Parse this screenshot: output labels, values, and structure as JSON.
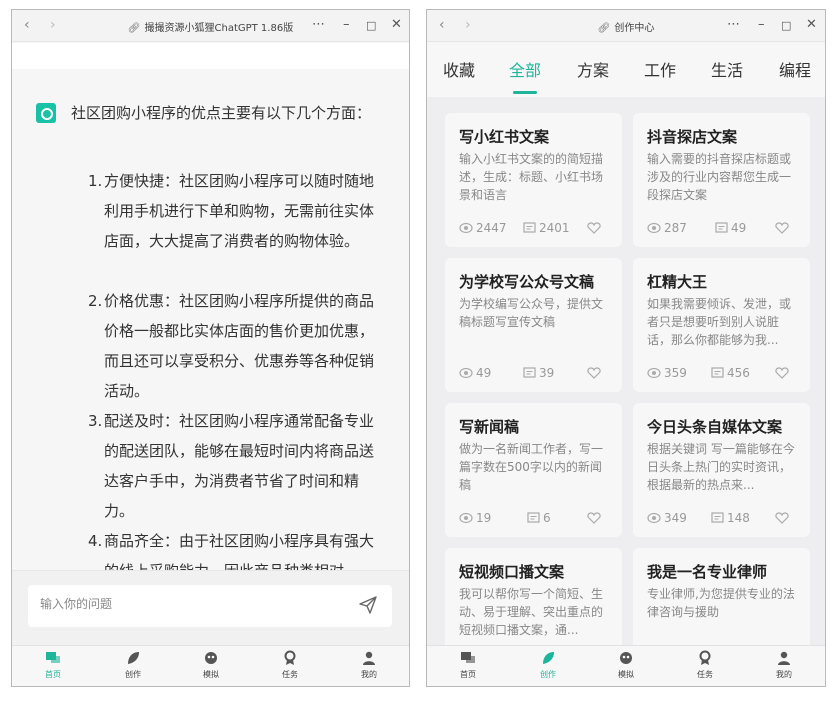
{
  "left_window": {
    "title": "撮撮资源小狐狸ChatGPT 1.86版",
    "message": {
      "intro": "社区团购小程序的优点主要有以下几个方面：",
      "points": [
        {
          "num": "1.",
          "text": "方便快捷：社区团购小程序可以随时随地利用手机进行下单和购物，无需前往实体店面，大大提高了消费者的购物体验。"
        },
        {
          "num": "2.",
          "text": "价格优惠：社区团购小程序所提供的商品价格一般都比实体店面的售价更加优惠，而且还可以享受积分、优惠券等各种促销活动。"
        },
        {
          "num": "3.",
          "text": "配送及时：社区团购小程序通常配备专业的配送团队，能够在最短时间内将商品送达客户手中，为消费者节省了时间和精力。"
        },
        {
          "num": "4.",
          "text": "商品齐全：由于社区团购小程序具有强大的线上采购能力，因此商品种类相对"
        }
      ]
    },
    "input": {
      "placeholder": "输入你的问题"
    },
    "tabs": [
      {
        "label": "首页",
        "icon": "chat-icon"
      },
      {
        "label": "创作",
        "icon": "leaf-icon"
      },
      {
        "label": "模拟",
        "icon": "mask-icon"
      },
      {
        "label": "任务",
        "icon": "medal-icon"
      },
      {
        "label": "我的",
        "icon": "user-icon"
      }
    ],
    "active_tab": "首页"
  },
  "right_window": {
    "title": "创作中心",
    "categories": [
      "收藏",
      "全部",
      "方案",
      "工作",
      "生活",
      "编程"
    ],
    "active_category": "全部",
    "cards": [
      {
        "title": "写小红书文案",
        "desc": "输入小红书文案的的简短描述，生成：标题、小红书场景和语言",
        "views": "2447",
        "comments": "2401"
      },
      {
        "title": "抖音探店文案",
        "desc": "输入需要的抖音探店标题或涉及的行业内容帮您生成一段探店文案",
        "views": "287",
        "comments": "49"
      },
      {
        "title": "为学校写公众号文稿",
        "desc": "为学校编写公众号，提供文稿标题写宣传文稿",
        "views": "49",
        "comments": "39"
      },
      {
        "title": "杠精大王",
        "desc": "如果我需要倾诉、发泄，或者只是想要听到别人说脏话，那么你都能够为我...",
        "views": "359",
        "comments": "456"
      },
      {
        "title": "写新闻稿",
        "desc": "做为一名新闻工作者，写一篇字数在500字以内的新闻稿",
        "views": "19",
        "comments": "6"
      },
      {
        "title": "今日头条自媒体文案",
        "desc": "根据关键词 写一篇能够在今日头条上热门的实时资讯，根据最新的热点来...",
        "views": "349",
        "comments": "148"
      },
      {
        "title": "短视频口播文案",
        "desc": "我可以帮你写一个简短、生动、易于理解、突出重点的短视频口播文案，通...",
        "views": "",
        "comments": ""
      },
      {
        "title": "我是一名专业律师",
        "desc": "专业律师,为您提供专业的法律咨询与援助",
        "views": "",
        "comments": ""
      }
    ],
    "tabs": [
      {
        "label": "首页",
        "icon": "chat-icon"
      },
      {
        "label": "创作",
        "icon": "leaf-icon"
      },
      {
        "label": "模拟",
        "icon": "mask-icon"
      },
      {
        "label": "任务",
        "icon": "medal-icon"
      },
      {
        "label": "我的",
        "icon": "user-icon"
      }
    ],
    "active_tab": "创作"
  },
  "colors": {
    "accent": "#1fb59b",
    "avatar": "#19c2a6"
  }
}
